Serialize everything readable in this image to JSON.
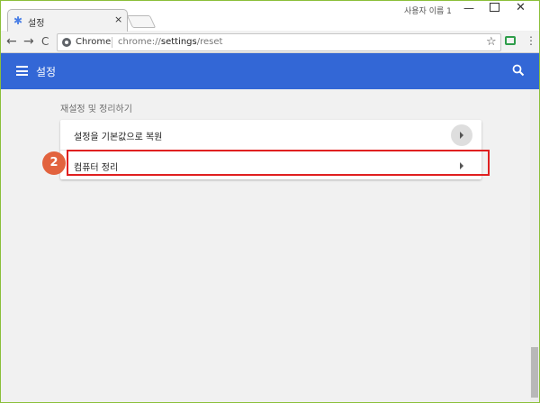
{
  "tab": {
    "title": "설정",
    "close": "×"
  },
  "window": {
    "profile": "사용자 이름 1",
    "minimize": "—",
    "close": "✕"
  },
  "toolbar": {
    "back": "←",
    "forward": "→",
    "reload": "C",
    "site_label": "Chrome",
    "url_prefix": "chrome://",
    "url_strong": "settings",
    "url_suffix": "/reset",
    "star": "☆",
    "menu": "⋮"
  },
  "header": {
    "title": "설정"
  },
  "section": {
    "title": "재설정 및 정리하기",
    "rows": [
      {
        "label": "설정을 기본값으로 복원"
      },
      {
        "label": "컴퓨터 정리"
      }
    ]
  },
  "annotation": {
    "step": "2"
  },
  "colors": {
    "header": "#3367d6",
    "highlight": "#e02020",
    "badge": "#e2633e",
    "tab_icon": "#4a7fe6"
  },
  "icons": {
    "tab": "gear-icon",
    "header_menu": "hamburger-icon",
    "search": "search-icon"
  }
}
